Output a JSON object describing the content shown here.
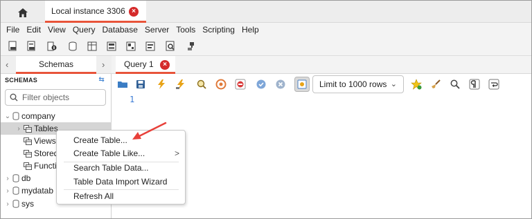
{
  "window": {
    "connection_tab": {
      "label": "Local instance 3306"
    }
  },
  "menubar": {
    "items": [
      "File",
      "Edit",
      "View",
      "Query",
      "Database",
      "Server",
      "Tools",
      "Scripting",
      "Help"
    ]
  },
  "sidebar": {
    "tab_label": "Schemas",
    "schemas_heading": "SCHEMAS",
    "filter_placeholder": "Filter objects",
    "tree": [
      {
        "label": "company",
        "expanded": true
      },
      {
        "label": "Tables",
        "selected": true
      },
      {
        "label": "Views"
      },
      {
        "label": "Stored"
      },
      {
        "label": "Functi"
      },
      {
        "label": "db"
      },
      {
        "label": "mydatab"
      },
      {
        "label": "sys"
      }
    ]
  },
  "editor": {
    "query_tab_label": "Query 1",
    "limit_select_value": "Limit to 1000 rows",
    "line_number": "1"
  },
  "context_menu": {
    "items": [
      {
        "label": "Create Table..."
      },
      {
        "label": "Create Table Like...",
        "submenu_marker": ">"
      },
      {
        "label": "Search Table Data..."
      },
      {
        "label": "Table Data Import Wizard"
      },
      {
        "label": "Refresh All"
      }
    ]
  },
  "colors": {
    "accent_tab_underline": "#e8543a",
    "close_badge": "#d52a2a",
    "annotation_arrow": "#e8403a",
    "line_number": "#3a7bd5"
  },
  "icons": {
    "home": "home-icon",
    "close": "close-icon",
    "filter": "search-icon",
    "database": "database-icon",
    "table_group": "table-icon",
    "refresh": "refresh-icon"
  }
}
